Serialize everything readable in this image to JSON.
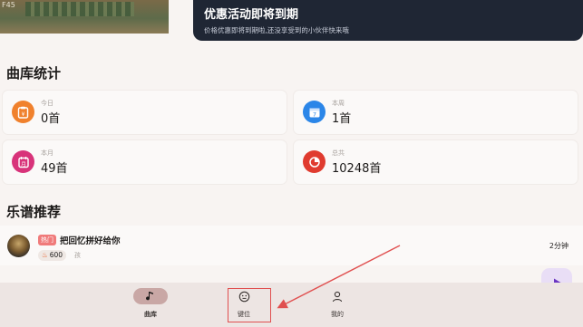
{
  "banner": {
    "left_corner_text": "F45",
    "promo_title": "优惠活动即将到期",
    "promo_subtitle": "价格优惠即将到期啦,还没享受到的小伙伴快来哦"
  },
  "stats": {
    "title": "曲库统计",
    "cards": [
      {
        "label": "今日",
        "value": "0首",
        "icon": "clipboard-icon",
        "color": "#f0812d"
      },
      {
        "label": "本周",
        "value": "1首",
        "icon": "calendar-week-icon",
        "color": "#2b86e8"
      },
      {
        "label": "本月",
        "value": "49首",
        "icon": "calendar-month-icon",
        "color": "#d8337a"
      },
      {
        "label": "总共",
        "value": "10248首",
        "icon": "pie-chart-icon",
        "color": "#e03b2f"
      }
    ]
  },
  "recommend": {
    "title": "乐谱推荐",
    "items": [
      {
        "tag": "热门",
        "name": "把回忆拼好给你",
        "heat": "600",
        "composer": "孩",
        "duration": "2分钟"
      }
    ]
  },
  "nav": {
    "items": [
      {
        "label": "曲库",
        "icon": "music-note-icon",
        "active": true
      },
      {
        "label": "键位",
        "icon": "keyboard-face-icon",
        "active": false
      },
      {
        "label": "我的",
        "icon": "person-icon",
        "active": false
      }
    ]
  },
  "colors": {
    "accent": "#7c4dca",
    "annotation": "#e05050",
    "promo_bg": "#1f2634"
  }
}
